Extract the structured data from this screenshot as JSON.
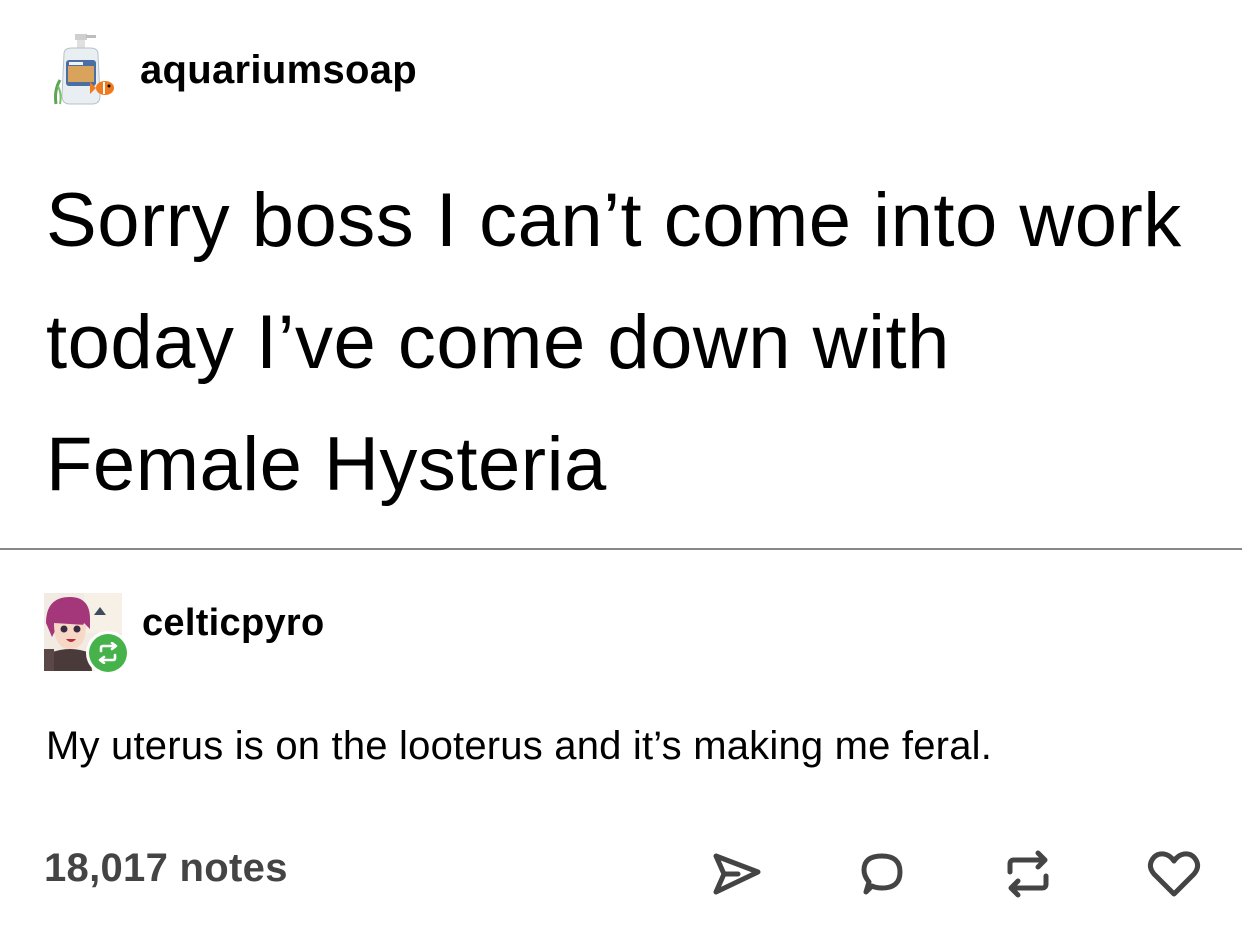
{
  "post": {
    "author": {
      "name": "aquariumsoap",
      "avatar_icon": "soap-bottle-avatar-icon"
    },
    "body": "Sorry boss I can’t come into work today I’ve come down with Female Hysteria"
  },
  "reblog": {
    "author": {
      "name": "celticpyro",
      "avatar_icon": "anime-character-avatar-icon",
      "badge_icon": "reblog-badge-icon"
    },
    "body": "My uterus is on the looterus and it’s making me feral."
  },
  "footer": {
    "notes_label": "18,017 notes",
    "actions": [
      {
        "name": "share",
        "icon": "share-icon"
      },
      {
        "name": "reply",
        "icon": "reply-icon"
      },
      {
        "name": "reblog",
        "icon": "reblog-icon"
      },
      {
        "name": "like",
        "icon": "heart-icon"
      }
    ]
  },
  "colors": {
    "text": "#000000",
    "notes_text": "#444444",
    "divider": "#888888",
    "reblog_badge": "#45b34a",
    "background": "#ffffff"
  }
}
